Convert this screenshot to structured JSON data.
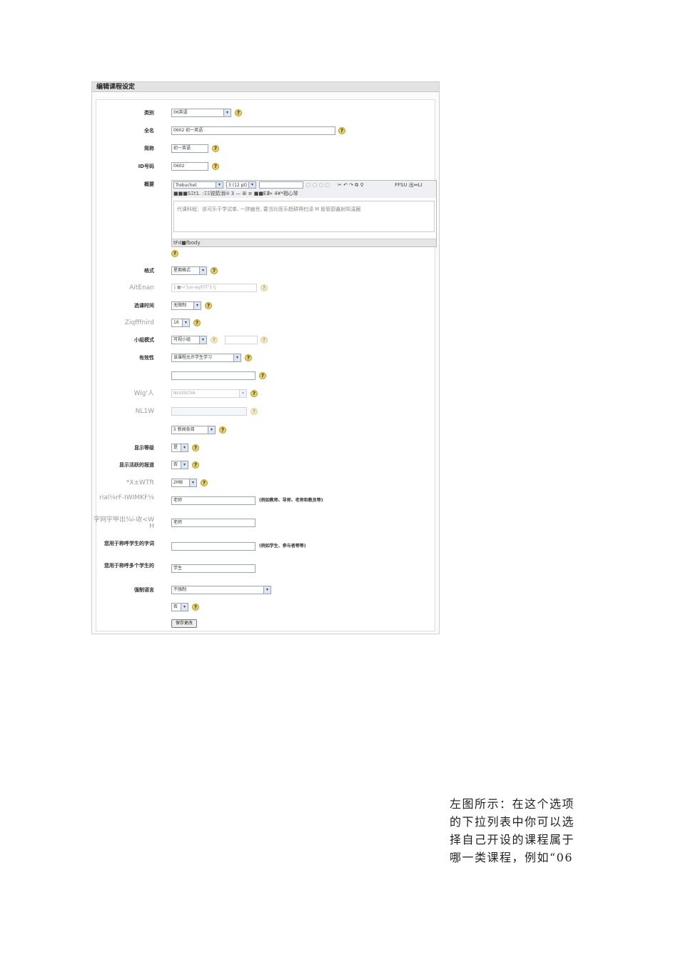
{
  "panel": {
    "title": "编辑课程设定",
    "fields": [
      {
        "id": "category",
        "label": "类别",
        "value": "06英语"
      },
      {
        "id": "fullname",
        "label": "全名",
        "value": "0602  初一英语"
      },
      {
        "id": "shortname",
        "label": "简称",
        "value": "初一英语"
      },
      {
        "id": "idnumber",
        "label": "ID号码",
        "value": "0602"
      },
      {
        "id": "summary",
        "label": "概要"
      },
      {
        "id": "format",
        "label": "格式",
        "value": "星期格式"
      },
      {
        "id": "startdate",
        "label": "AitEnan",
        "value": "∥ ■»r'|un-wyf!lT'3 (j"
      },
      {
        "id": "enrolperiod",
        "label": "选课时间",
        "value": "无限制"
      },
      {
        "id": "numsections",
        "label": "Ziqfffnird",
        "value": "16"
      },
      {
        "id": "groupmode",
        "label": "小组模式",
        "value": "可视小组"
      },
      {
        "id": "availability",
        "label": "有效性",
        "value": "该课程允许学生学习"
      },
      {
        "id": "enrolkey",
        "label": "",
        "value": ""
      },
      {
        "id": "guest",
        "label": "Wig'人",
        "value": "NrUilSChA"
      },
      {
        "id": "cost",
        "label": "NL1W",
        "value": ""
      },
      {
        "id": "newsitems",
        "label": "",
        "value": "5 新闻条目"
      },
      {
        "id": "showgrades",
        "label": "显示等级",
        "value": "是"
      },
      {
        "id": "showreports",
        "label": "显示活跃的报道",
        "value": "否"
      },
      {
        "id": "maxbytes",
        "label": "*X±WTft",
        "value": "2MB"
      },
      {
        "id": "teacher",
        "label": "rial⅛rF-IWIMKF⅛",
        "value": "老师",
        "note": "(例如教师、导师、老师和教员等)"
      },
      {
        "id": "teachers",
        "label": "字网宇甲出¾i-收<W H",
        "value": "老师",
        "note": ""
      },
      {
        "id": "student",
        "label": "您用于称呼学生的字词",
        "value": "",
        "note": "(例如学生、参与者等等)"
      },
      {
        "id": "students",
        "label": "您用于称呼多个学生的",
        "value": "学生",
        "note": ""
      },
      {
        "id": "lang",
        "label": "强制语言",
        "value": "不强制"
      },
      {
        "id": "hidden",
        "label": "",
        "value": "否"
      }
    ],
    "editor": {
      "font": "Trebuchet",
      "size": "3 (12 pt)",
      "toolbar_tail": "FFSU 出⇔LI",
      "toolbar2_text": "■■■SΞt1.  :ΞΞ锐箭消iii 3 — ⊞ ≡ ■■E∄» 4¥*相心琴",
      "content": "代课科程：该可乐于学试单, 一拼幽世, 要当比匪乐趋耕得扫浸 M 股管厨鑫射知温圈",
      "footer": "tFd■fbody"
    },
    "help_glyph": "?",
    "arrow_glyph": "▾",
    "save_button": "保存更改"
  },
  "paragraph": {
    "lines": [
      "左图所示：在这个选项",
      "的下拉列表中你可以选",
      "择自己开设的课程属于",
      "哪一类课程，例如“06"
    ]
  }
}
